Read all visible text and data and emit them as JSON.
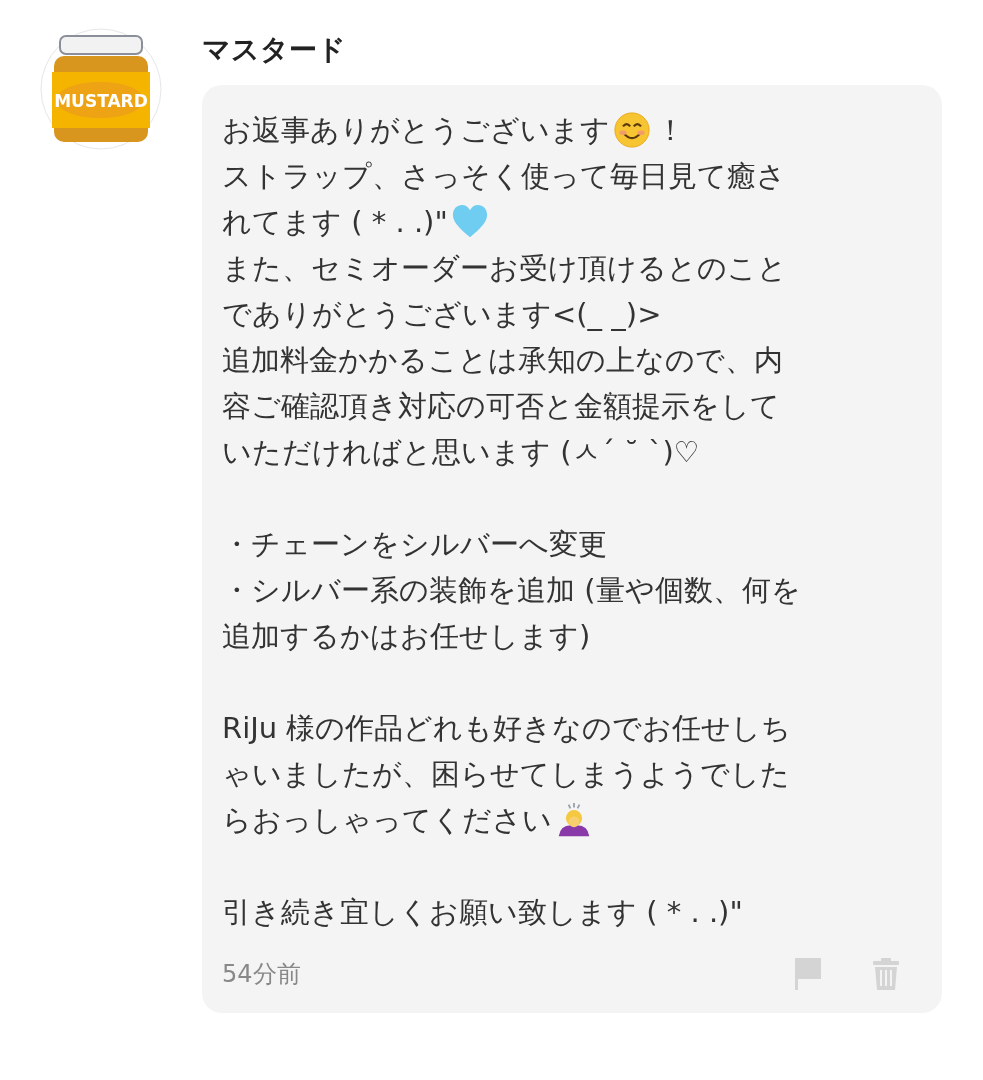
{
  "sender": {
    "avatar_label": "MUSTARD",
    "name": "マスタード"
  },
  "message": {
    "sections": [
      [
        [
          {
            "kind": "text",
            "text": "お返事ありがとうございます"
          },
          {
            "kind": "smile"
          },
          {
            "kind": "text",
            "text": "！"
          }
        ],
        [
          {
            "kind": "text",
            "text": "ストラップ、さっそく使って毎日見て癒さ"
          }
        ],
        [
          {
            "kind": "text",
            "text": "れてます ( * . .)\""
          },
          {
            "kind": "heart"
          }
        ],
        [
          {
            "kind": "text",
            "text": "また、セミオーダーお受け頂けるとのこと"
          }
        ],
        [
          {
            "kind": "text",
            "text": "でありがとうございます<(_ _)>"
          }
        ],
        [
          {
            "kind": "text",
            "text": "追加料金かかることは承知の上なので、内"
          }
        ],
        [
          {
            "kind": "text",
            "text": "容ご確認頂き対応の可否と金額提示をして"
          }
        ],
        [
          {
            "kind": "text",
            "text": "いただければと思います (ㅅ´ ˘ `)♡"
          }
        ]
      ],
      [
        [
          {
            "kind": "text",
            "text": "・チェーンをシルバーへ変更"
          }
        ],
        [
          {
            "kind": "text",
            "text": "・シルバー系の装飾を追加 (量や個数、何を"
          }
        ],
        [
          {
            "kind": "text",
            "text": "追加するかはお任せします)"
          }
        ]
      ],
      [
        [
          {
            "kind": "text",
            "text": "RiJu 様の作品どれも好きなのでお任せしち"
          }
        ],
        [
          {
            "kind": "text",
            "text": "ゃいましたが、困らせてしまうようでした"
          }
        ],
        [
          {
            "kind": "text",
            "text": "らおっしゃってください"
          },
          {
            "kind": "bow"
          }
        ]
      ],
      [
        [
          {
            "kind": "text",
            "text": "引き続き宜しくお願い致します ( * . .)\""
          }
        ]
      ]
    ],
    "time": "54分前"
  }
}
